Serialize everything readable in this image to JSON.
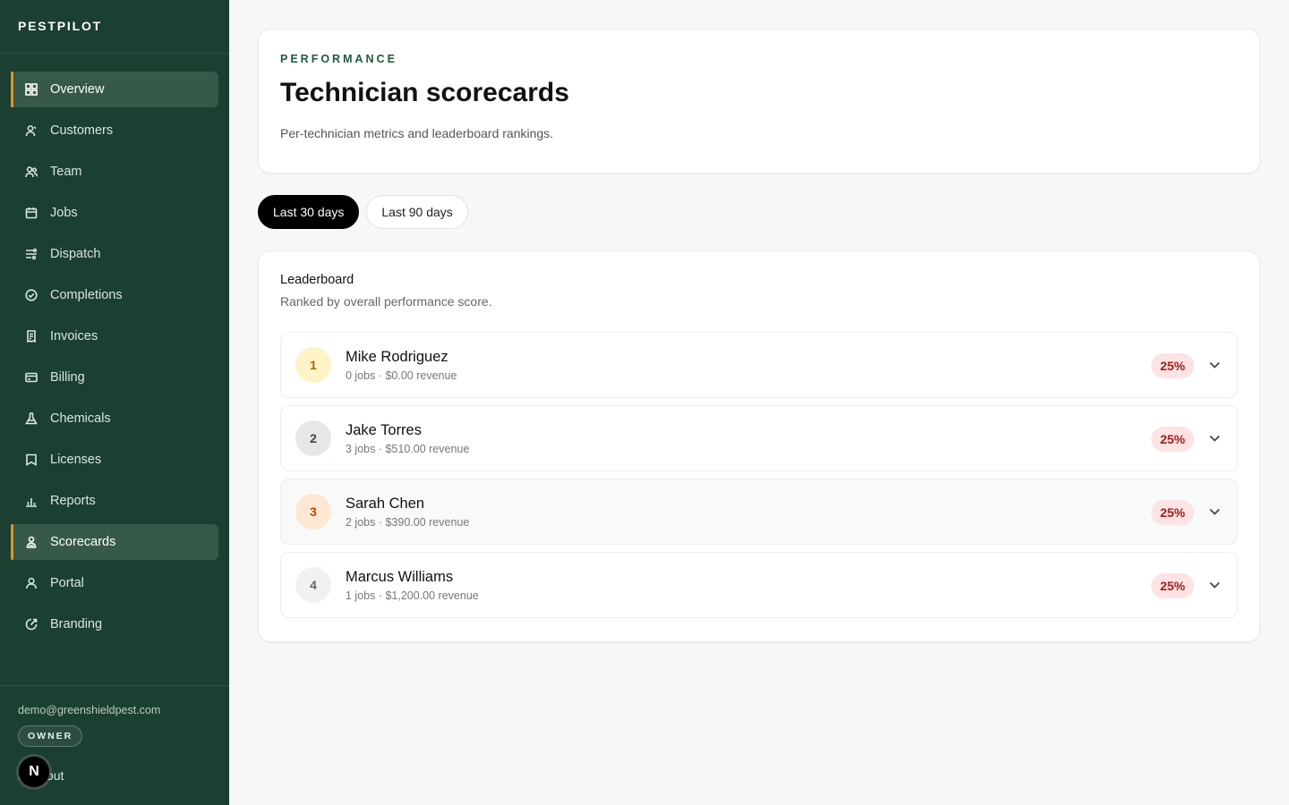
{
  "app": {
    "name": "PESTPILOT"
  },
  "sidebar": {
    "items": [
      {
        "label": "Overview",
        "icon": "grid-icon"
      },
      {
        "label": "Customers",
        "icon": "customer-icon"
      },
      {
        "label": "Team",
        "icon": "team-icon"
      },
      {
        "label": "Jobs",
        "icon": "calendar-icon"
      },
      {
        "label": "Dispatch",
        "icon": "dispatch-icon"
      },
      {
        "label": "Completions",
        "icon": "check-circle-icon"
      },
      {
        "label": "Invoices",
        "icon": "receipt-icon"
      },
      {
        "label": "Billing",
        "icon": "credit-card-icon"
      },
      {
        "label": "Chemicals",
        "icon": "flask-icon"
      },
      {
        "label": "Licenses",
        "icon": "license-icon"
      },
      {
        "label": "Reports",
        "icon": "bar-chart-icon"
      },
      {
        "label": "Scorecards",
        "icon": "badge-icon"
      },
      {
        "label": "Portal",
        "icon": "user-icon"
      },
      {
        "label": "Branding",
        "icon": "palette-icon"
      }
    ],
    "active": [
      "Overview",
      "Scorecards"
    ],
    "user_email": "demo@greenshieldpest.com",
    "role": "OWNER",
    "signout_label": "Sign out",
    "dev_badge": "N"
  },
  "header": {
    "eyebrow": "PERFORMANCE",
    "title": "Technician scorecards",
    "subtitle": "Per-technician metrics and leaderboard rankings."
  },
  "tabs": [
    {
      "label": "Last 30 days",
      "active": true
    },
    {
      "label": "Last 90 days",
      "active": false
    }
  ],
  "leaderboard": {
    "title": "Leaderboard",
    "subtitle": "Ranked by overall performance score.",
    "rows": [
      {
        "rank": "1",
        "name": "Mike Rodriguez",
        "meta": "0 jobs · $0.00 revenue",
        "score": "25%"
      },
      {
        "rank": "2",
        "name": "Jake Torres",
        "meta": "3 jobs · $510.00 revenue",
        "score": "25%"
      },
      {
        "rank": "3",
        "name": "Sarah Chen",
        "meta": "2 jobs · $390.00 revenue",
        "score": "25%"
      },
      {
        "rank": "4",
        "name": "Marcus Williams",
        "meta": "1 jobs · $1,200.00 revenue",
        "score": "25%"
      }
    ]
  },
  "colors": {
    "sidebar_bg": "#1b3f30",
    "accent": "#e0932e",
    "score_badge_bg": "#fde3e3",
    "score_badge_text": "#a01d1d"
  }
}
